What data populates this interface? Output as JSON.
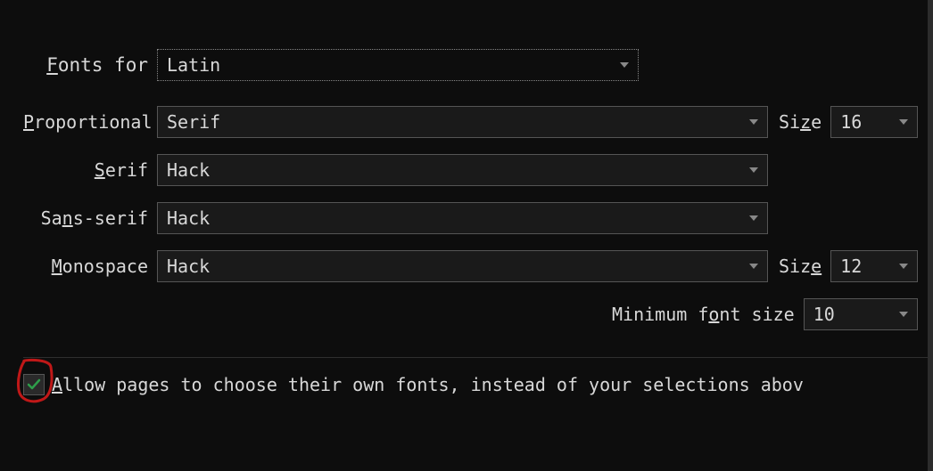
{
  "header": {
    "fonts_for_label_pre": "F",
    "fonts_for_label_post": "onts for",
    "script_select": "Latin"
  },
  "rows": {
    "proportional": {
      "label_pre": "P",
      "label_post": "roportional",
      "value": "Serif",
      "size_label_pre": "Si",
      "size_label_u": "z",
      "size_label_post": "e",
      "size_value": "16"
    },
    "serif": {
      "label_pre": "S",
      "label_post": "erif",
      "label_u": "S",
      "value": "Hack"
    },
    "sans": {
      "label_pre": "Sa",
      "label_u": "n",
      "label_post": "s-serif",
      "value": "Hack"
    },
    "mono": {
      "label_u": "M",
      "label_post": "onospace",
      "value": "Hack",
      "size_label_pre": "Siz",
      "size_label_u": "e",
      "size_value": "12"
    }
  },
  "min": {
    "label_pre": "Minimum f",
    "label_u": "o",
    "label_post": "nt size",
    "value": "10"
  },
  "allow": {
    "checked": true,
    "label_u": "A",
    "label_post": "llow pages to choose their own fonts, instead of your selections abov"
  }
}
